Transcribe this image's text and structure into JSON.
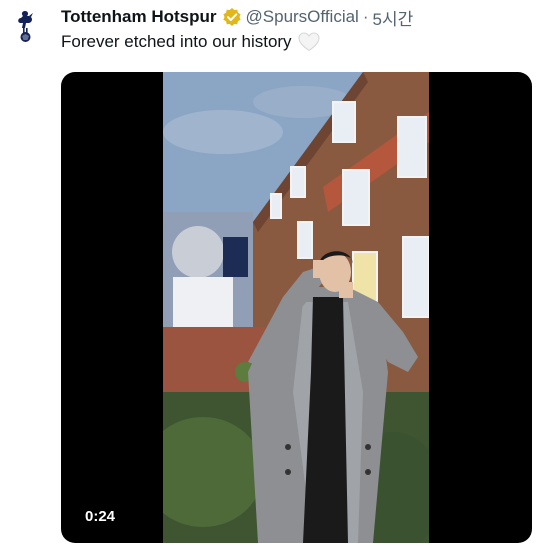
{
  "author": {
    "display_name": "Tottenham Hotspur",
    "handle": "@SpursOfficial",
    "separator": "·",
    "time_ago": "5시간",
    "avatar_icon": "spurs-cockerel-logo",
    "verified_icon": "gold-verified-badge"
  },
  "tweet": {
    "text": "Forever etched into our history",
    "emoji_icon": "white-heart-icon"
  },
  "media": {
    "type": "video",
    "duration": "0:24"
  },
  "colors": {
    "name": "#0f1419",
    "secondary": "#536471",
    "verified_gold": "#e2b719",
    "video_bg": "#000000"
  }
}
